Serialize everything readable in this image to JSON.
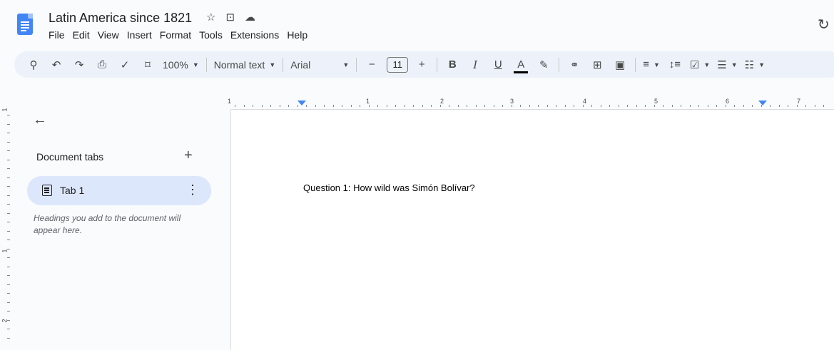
{
  "document": {
    "title": "Latin America since 1821",
    "body_text": "Question 1: How wild was Simón Bolívar?"
  },
  "title_icons": [
    "star-icon",
    "move-to-folder-icon",
    "cloud-saved-icon"
  ],
  "menu": [
    "File",
    "Edit",
    "View",
    "Insert",
    "Format",
    "Tools",
    "Extensions",
    "Help"
  ],
  "toolbar": {
    "zoom": "100%",
    "style": "Normal text",
    "font": "Arial",
    "font_size": "11",
    "minus": "−",
    "plus": "+",
    "bold": "B",
    "italic": "I",
    "underline": "U",
    "text_color": "A"
  },
  "ruler": {
    "labels": [
      "1",
      "1",
      "2",
      "3",
      "4",
      "5",
      "6",
      "7"
    ]
  },
  "vertical_ruler": {
    "labels": [
      "1",
      "1",
      "2"
    ]
  },
  "sidebar": {
    "tabs_title": "Document tabs",
    "add": "+",
    "tab_label": "Tab 1",
    "outline_hint": "Headings you add to the document will appear here."
  },
  "colors": {
    "accent": "#4285f4",
    "toolbar_bg": "#edf2fa",
    "active_tab_bg": "#dde7fb"
  }
}
